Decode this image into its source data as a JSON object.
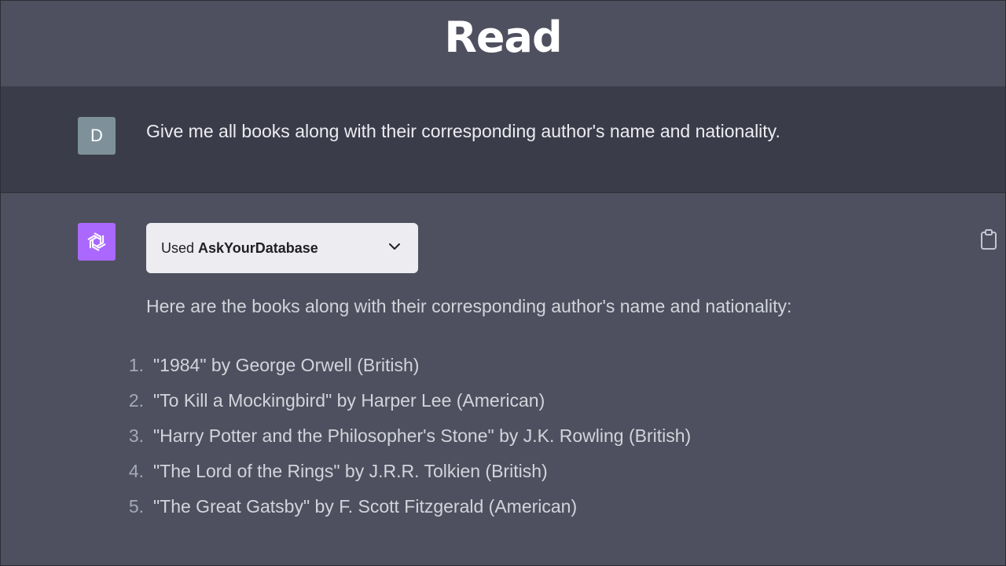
{
  "header": {
    "title": "Read"
  },
  "user_message": {
    "avatar_letter": "D",
    "text": "Give me all books along with their corresponding author's name and nationality."
  },
  "assistant_message": {
    "plugin": {
      "prefix": "Used",
      "name": "AskYourDatabase"
    },
    "intro": "Here are the books along with their corresponding author's name and nationality:",
    "books": [
      {
        "num": "1.",
        "text": "\"1984\" by George Orwell (British)"
      },
      {
        "num": "2.",
        "text": "\"To Kill a Mockingbird\" by Harper Lee (American)"
      },
      {
        "num": "3.",
        "text": "\"Harry Potter and the Philosopher's Stone\" by J.K. Rowling (British)"
      },
      {
        "num": "4.",
        "text": "\"The Lord of the Rings\" by J.R.R. Tolkien (British)"
      },
      {
        "num": "5.",
        "text": "\"The Great Gatsby\" by F. Scott Fitzgerald (American)"
      }
    ]
  },
  "icons": {
    "assistant_avatar": "openai-logo-icon",
    "dropdown": "chevron-down-icon",
    "copy": "clipboard-icon"
  },
  "colors": {
    "page_bg": "#4f505f",
    "user_row_bg": "#3b3c4a",
    "user_avatar_bg": "#7e919a",
    "assistant_avatar_bg": "#ab68ff",
    "plugin_pill_bg": "#ececf1"
  }
}
